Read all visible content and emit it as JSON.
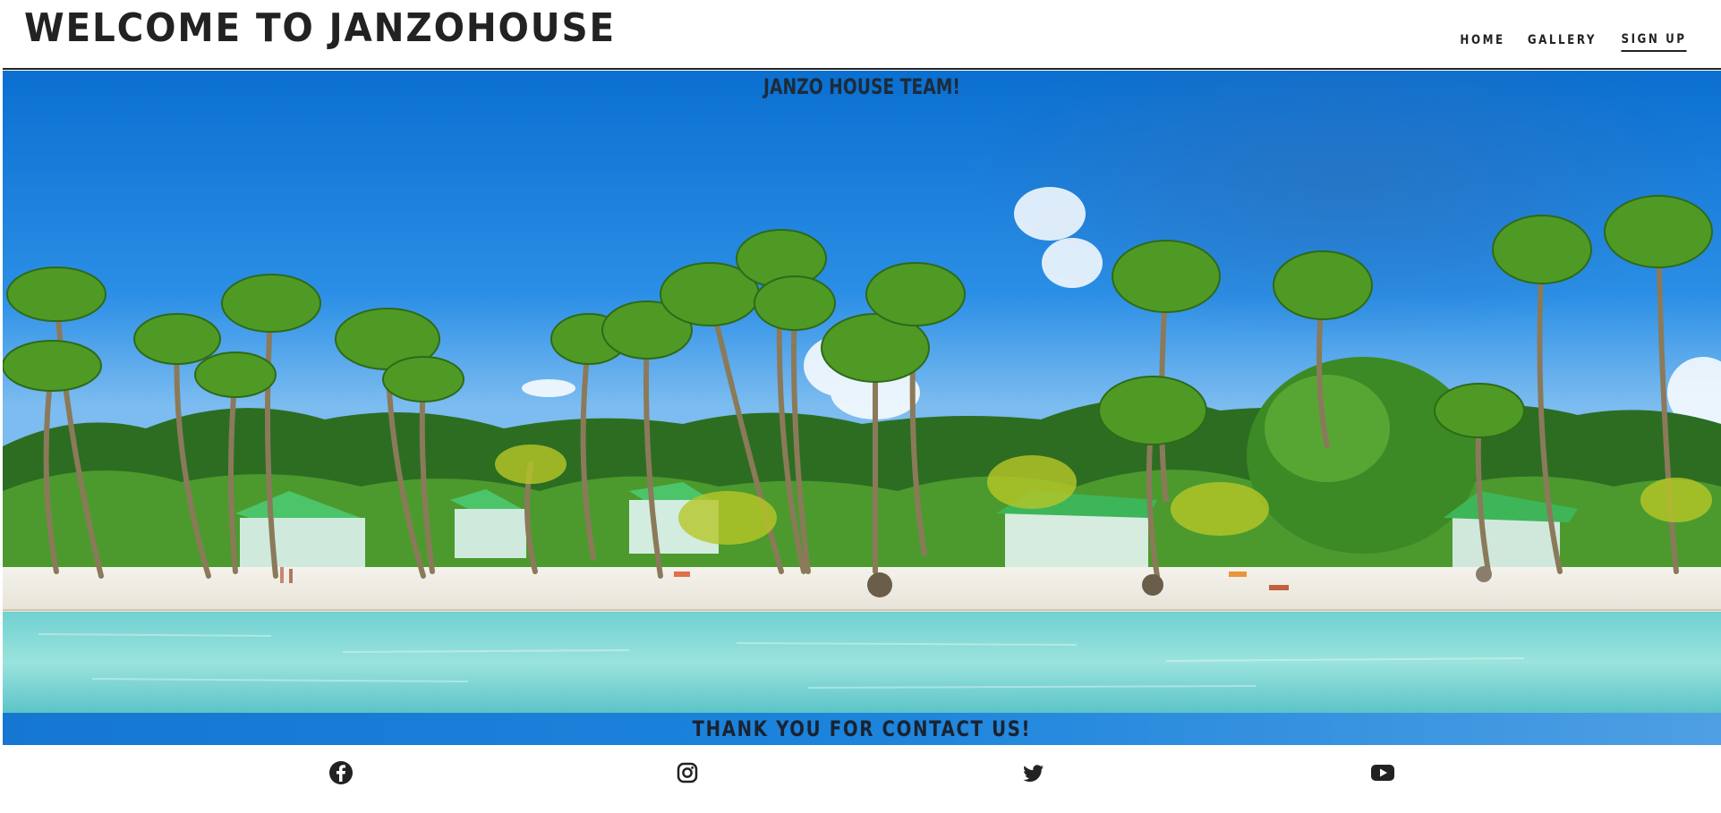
{
  "header": {
    "site_title": "WELCOME TO JANZOHOUSE",
    "nav": [
      {
        "label": "HOME",
        "active": false
      },
      {
        "label": "GALLERY",
        "active": false
      },
      {
        "label": "SIGN UP",
        "active": true
      }
    ]
  },
  "hero": {
    "caption": "JANZO HOUSE TEAM!",
    "image_subject": "tropical-beach-palm-trees"
  },
  "banner": {
    "text": "THANK YOU FOR CONTACT US!"
  },
  "social": {
    "icons": [
      "facebook-icon",
      "instagram-icon",
      "twitter-icon",
      "youtube-icon"
    ]
  },
  "colors": {
    "sky": "#1c86e3",
    "sand": "#f1efe9",
    "water": "#7fd6d6",
    "palm_green": "#3f8f2a",
    "text_dark": "#222222",
    "banner_blue": "#1c84dc"
  }
}
